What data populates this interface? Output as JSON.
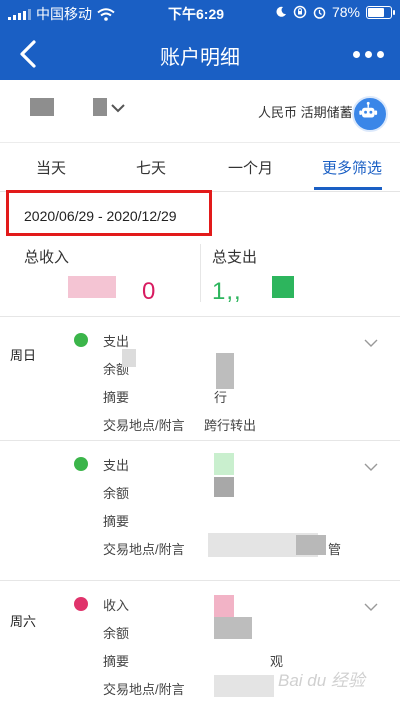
{
  "status_bar": {
    "carrier": "中国移动",
    "time": "下午6:29",
    "battery": "78%",
    "battery_level": 0.78
  },
  "header": {
    "title": "账户明细",
    "back_icon": "chevron-left-icon",
    "more_icon": "more-dots-icon"
  },
  "account": {
    "currency_type": "人民币 活期储蓄"
  },
  "tabs": [
    "当天",
    "七天",
    "一个月",
    "更多筛选"
  ],
  "active_tab": "更多筛选",
  "date_range": "2020/06/29 - 2020/12/29",
  "summary": {
    "income_label": "总收入",
    "expense_label": "总支出",
    "income_value_visible": "0",
    "expense_value_visible": "1,,",
    "income_color": "#d81b60",
    "expense_color": "#2db55d"
  },
  "transactions": [
    {
      "day": "周日",
      "dot_color": "#3bb54a",
      "rows": [
        {
          "label": "支出",
          "value": ""
        },
        {
          "label": "余额",
          "value": ""
        },
        {
          "label": "摘要",
          "value": "行"
        },
        {
          "label": "交易地点/附言",
          "value": "跨行转出"
        }
      ]
    },
    {
      "day": "",
      "dot_color": "#3bb54a",
      "rows": [
        {
          "label": "支出",
          "value": ""
        },
        {
          "label": "余额",
          "value": ""
        },
        {
          "label": "摘要",
          "value": ""
        },
        {
          "label": "交易地点/附言",
          "value": "管"
        }
      ]
    },
    {
      "day": "周六",
      "dot_color": "#e0336b",
      "rows": [
        {
          "label": "收入",
          "value": ""
        },
        {
          "label": "余额",
          "value": ""
        },
        {
          "label": "摘要",
          "value": "观"
        },
        {
          "label": "交易地点/附言",
          "value": ""
        }
      ]
    }
  ],
  "colors": {
    "brand_blue": "#1a5fc4",
    "highlight_red": "#e21a1a"
  }
}
